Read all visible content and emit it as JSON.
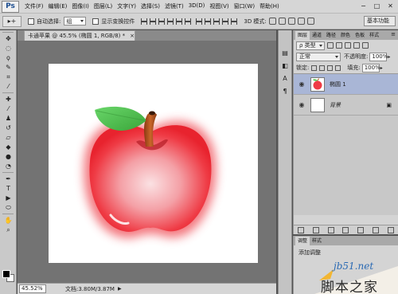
{
  "app": {
    "logo": "Ps"
  },
  "menubar": {
    "items": [
      "文件(F)",
      "编辑(E)",
      "图像(I)",
      "图层(L)",
      "文字(Y)",
      "选择(S)",
      "滤镜(T)",
      "3D(D)",
      "视图(V)",
      "窗口(W)",
      "帮助(H)"
    ],
    "minimize": "−",
    "restore": "□",
    "close": "✕"
  },
  "options": {
    "tool_icon": "▸+",
    "auto_select_label": "自动选择:",
    "auto_select_value": "组",
    "show_transform_label": "显示变换控件",
    "mode_3d_label": "3D 模式:",
    "workspace": "基本功能"
  },
  "document": {
    "tab_title": "卡通苹果 @ 45.5% (椭圆 1, RGB/8) *",
    "close": "×"
  },
  "status": {
    "zoom": "45.52%",
    "doc_info": "文档:3.80M/3.87M",
    "arrow": "▶"
  },
  "layers_panel": {
    "tabs": [
      "图层",
      "通道",
      "路径",
      "颜色",
      "色板",
      "样式"
    ],
    "menu": "≡",
    "filter_kind": "ρ 类型",
    "blend_mode": "正常",
    "opacity_label": "不透明度:",
    "opacity_value": "100%",
    "lock_label": "锁定:",
    "fill_label": "填充:",
    "fill_value": "100%",
    "layers": [
      {
        "name": "椭圆 1",
        "selected": true
      },
      {
        "name": "背景",
        "selected": false
      }
    ],
    "lock_symbol": "🔒"
  },
  "adjust_panel": {
    "tabs": [
      "调整",
      "样式"
    ],
    "title": "添加调整"
  },
  "watermark": {
    "domain": "jb51.net",
    "text": "脚本之家"
  },
  "colors": {
    "apple_red": "#ef3b45",
    "leaf_green": "#4fc24f",
    "stem_brown": "#b5551e",
    "selected_layer": "#a9b6d6"
  }
}
